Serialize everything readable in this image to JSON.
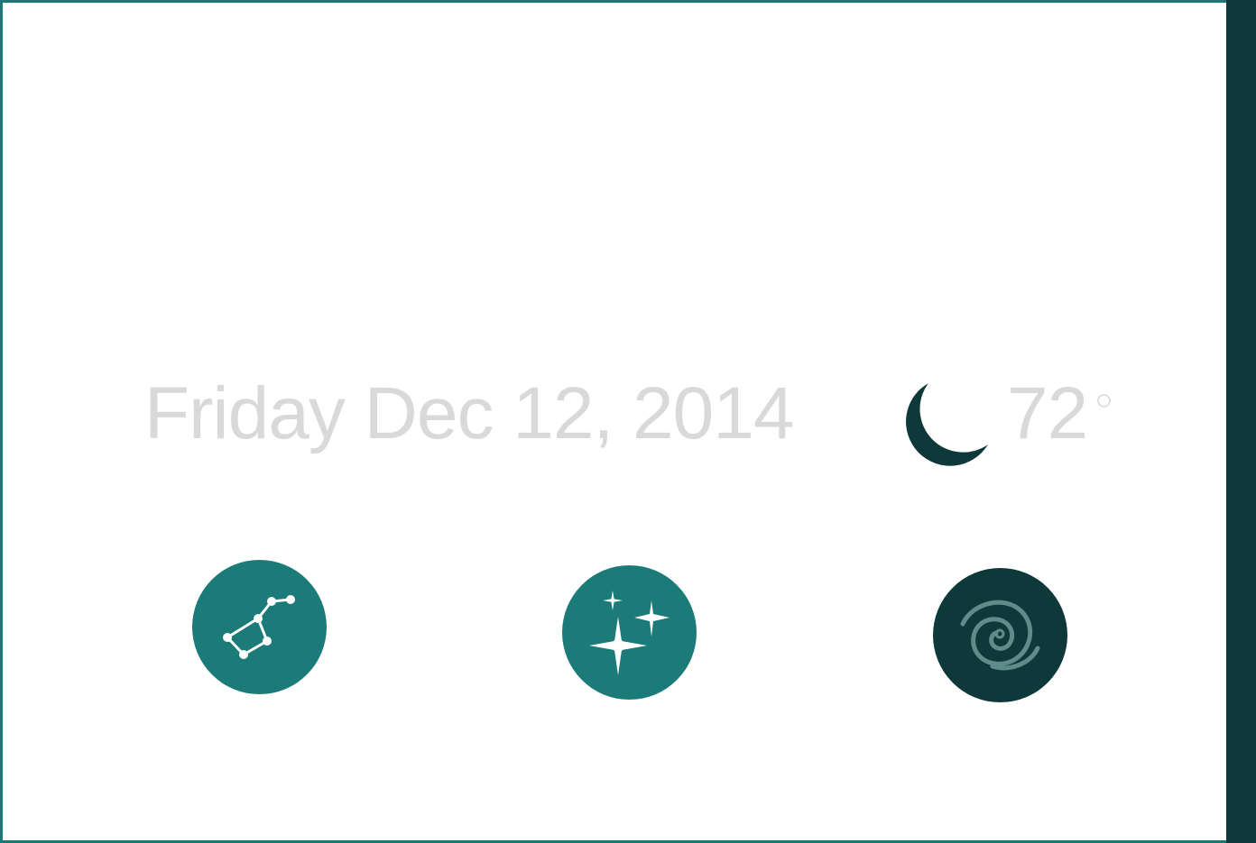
{
  "header": {
    "day": "Friday",
    "date": "Dec 12, 2014",
    "temperature": "72",
    "weather_icon": "crescent-moon-icon"
  },
  "buttons": [
    {
      "name": "constellation",
      "icon": "constellation-icon"
    },
    {
      "name": "stars",
      "icon": "sparkle-stars-icon"
    },
    {
      "name": "galaxy",
      "icon": "spiral-galaxy-icon"
    }
  ],
  "colors": {
    "teal": "#1a7b78",
    "dark_teal": "#0e3839",
    "text_light_gray": "#d9d9d9",
    "galaxy_stroke": "#5f8c8a"
  }
}
